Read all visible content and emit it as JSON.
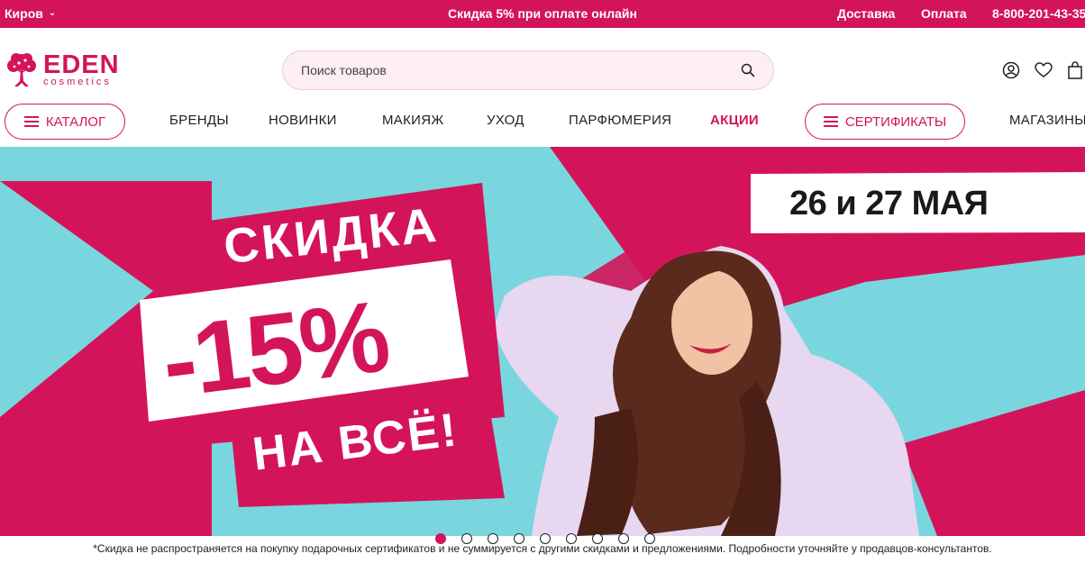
{
  "topbar": {
    "city": "Киров",
    "promo": "Скидка 5% при оплате онлайн",
    "delivery": "Доставка",
    "payment": "Оплата",
    "phone": "8-800-201-43-35"
  },
  "logo": {
    "brand": "EDEN",
    "sub": "cosmetics"
  },
  "search": {
    "placeholder": "Поиск товаров"
  },
  "header_icons": [
    "user-icon",
    "heart-icon",
    "bag-icon"
  ],
  "nav": {
    "catalog": "КАТАЛОГ",
    "items": [
      "БРЕНДЫ",
      "НОВИНКИ",
      "МАКИЯЖ",
      "УХОД",
      "ПАРФЮМЕРИЯ",
      "АКЦИИ"
    ],
    "certificates": "СЕРТИФИКАТЫ",
    "stores": "МАГАЗИНЫ"
  },
  "banner": {
    "word": "СКИДКА",
    "percent": "-15%",
    "everything": "НА ВСЁ!",
    "dates": "26 и 27 МАЯ"
  },
  "slider": {
    "count": 9,
    "active_index": 0
  },
  "disclaimer": "*Скидка не распространяется на покупку подарочных сертификатов и не суммируется с другими скидками и предложениями. Подробности уточняйте у продавцов-консультантов.",
  "colors": {
    "brand": "#d4145a",
    "banner_bg": "#79d6df",
    "search_bg": "#fdeef2"
  }
}
